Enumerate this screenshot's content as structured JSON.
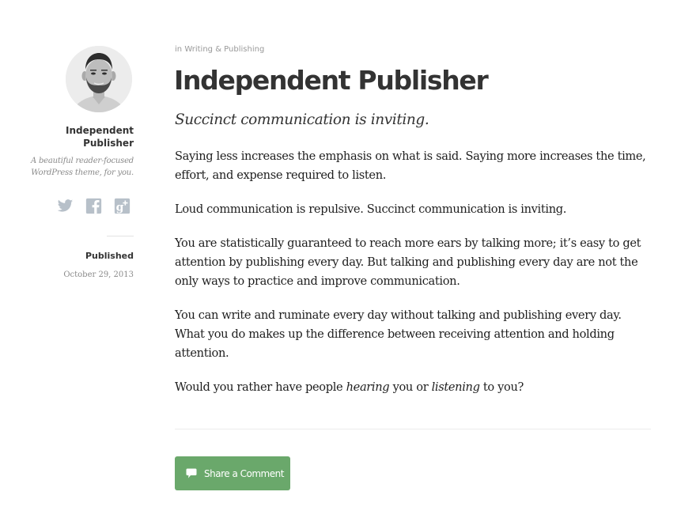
{
  "sidebar": {
    "avatar_alt": "Author avatar",
    "site_title": "Independent Publisher",
    "site_description": "A beautiful reader-focused WordPress theme, for you.",
    "social_links": [
      {
        "name": "twitter",
        "icon": "twitter-icon"
      },
      {
        "name": "facebook",
        "icon": "facebook-icon"
      },
      {
        "name": "google-plus",
        "icon": "google-plus-icon"
      }
    ],
    "social_icon_color": "#b7c0c9",
    "published_label": "Published",
    "published_date": "October 29, 2013"
  },
  "post": {
    "category_prefix": "in",
    "category": "Writing & Publishing",
    "title": "Independent Publisher",
    "subtitle": "Succinct communication is inviting.",
    "paragraphs": [
      {
        "text": "Saying less increases the emphasis on what is said. Saying more increases the time, effort, and expense required to listen."
      },
      {
        "text": "Loud communication is repulsive. Succinct communication is inviting."
      },
      {
        "text": "You are statistically guaranteed to reach more ears by talking more; it’s easy to get attention by publishing every day. But talking and publishing every day are not the only ways to practice and improve communication."
      },
      {
        "text": "You can write and ruminate every day without talking and publishing every day. What you do makes up the difference between receiving attention and holding attention."
      }
    ],
    "last_paragraph": {
      "part1": "Would you rather have people ",
      "em1": "hearing",
      "part2": " you or ",
      "em2": "listening",
      "part3": " to you?"
    }
  },
  "comments": {
    "button_label": "Share a Comment",
    "button_icon": "comment-icon",
    "button_color": "#6aa86b"
  }
}
